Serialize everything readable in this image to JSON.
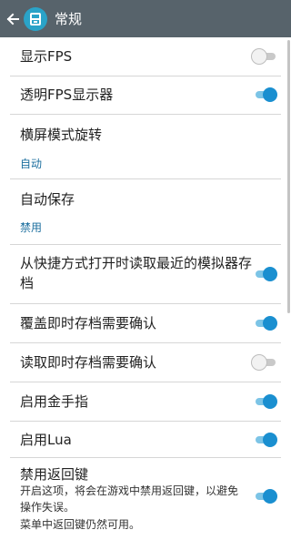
{
  "header": {
    "title": "常规",
    "back_icon": "arrow-left-icon",
    "app_icon": "app-logo-icon"
  },
  "settings": [
    {
      "label": "显示FPS",
      "type": "toggle",
      "on": false
    },
    {
      "label": "透明FPS显示器",
      "type": "toggle",
      "on": true
    },
    {
      "label": "横屏模式旋转",
      "type": "value",
      "value": "自动"
    },
    {
      "label": "自动保存",
      "type": "value",
      "value": "禁用"
    },
    {
      "label": "从快捷方式打开时读取最近的模拟器存",
      "label2": "档",
      "type": "toggle",
      "on": true
    },
    {
      "label": "覆盖即时存档需要确认",
      "type": "toggle",
      "on": true
    },
    {
      "label": "读取即时存档需要确认",
      "type": "toggle",
      "on": false
    },
    {
      "label": "启用金手指",
      "type": "toggle",
      "on": true
    },
    {
      "label": "启用Lua",
      "type": "toggle",
      "on": true
    },
    {
      "label": "禁用返回键",
      "type": "toggle",
      "on": true,
      "desc1": "开启这项，将会在游戏中禁用返回键，以避免",
      "desc2": "操作失误。",
      "desc3": "菜单中返回键仍然可用。"
    }
  ],
  "colors": {
    "accent": "#1a8fd0",
    "appbar": "#57636b",
    "logo": "#2aa3c8"
  }
}
